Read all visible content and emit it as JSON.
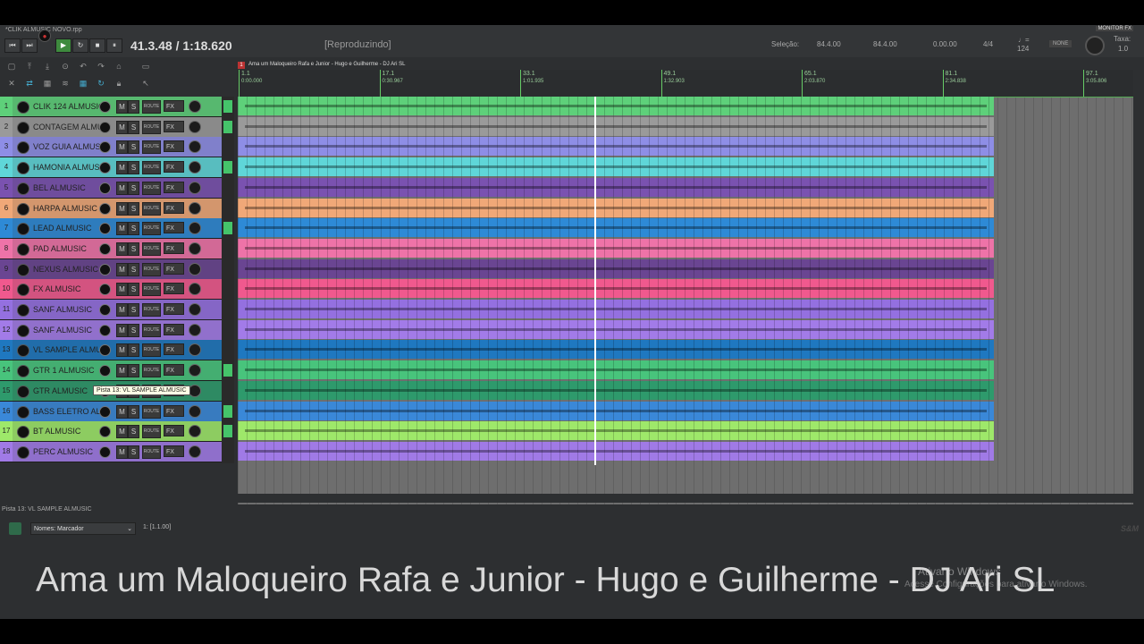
{
  "window": {
    "title": "*CLIK ALMUSIC NOVO.rpp",
    "monitor_fx": "MONITOR FX"
  },
  "transport": {
    "position": "41.3.48 / 1:18.620",
    "state": "[Reproduzindo]",
    "buttons": [
      "⏮",
      "⏭",
      "●",
      "▶",
      "↻",
      "■",
      "⏸"
    ]
  },
  "selection": {
    "label": "Seleção:",
    "start": "84.4.00",
    "end": "84.4.00",
    "length": "0.00.00",
    "timesig": "4/4",
    "bpm_icon": "♩=",
    "bpm": "124",
    "metronome": "NONE",
    "rate_label": "Taxa:",
    "rate": "1.0"
  },
  "project": {
    "marker_num": "1",
    "marker_label": "Ama um Maloqueiro Rafa e Junior - Hugo e Guilherme - DJ Ari SL"
  },
  "ruler": [
    {
      "bar": "1.1",
      "time": "0:00.000"
    },
    {
      "bar": "17.1",
      "time": "0:30.967"
    },
    {
      "bar": "33.1",
      "time": "1:01.935"
    },
    {
      "bar": "49.1",
      "time": "1:32.903"
    },
    {
      "bar": "65.1",
      "time": "2:03.870"
    },
    {
      "bar": "81.1",
      "time": "2:34.838"
    },
    {
      "bar": "97.1",
      "time": "3:05.806"
    }
  ],
  "track_labels": {
    "mute": "M",
    "solo": "S",
    "route": "ROUTE",
    "fx": "FX"
  },
  "tracks": [
    {
      "num": "1",
      "name": "CLIK 124 ALMUSIC",
      "color": "#5ed07a"
    },
    {
      "num": "2",
      "name": "CONTAGEM ALMUSIC",
      "color": "#9a9a9a"
    },
    {
      "num": "3",
      "name": "VOZ GUIA ALMUSIC",
      "color": "#8e8ee6"
    },
    {
      "num": "4",
      "name": "HAMONIA ALMUSIC",
      "color": "#5fd6d8"
    },
    {
      "num": "5",
      "name": "BEL ALMUSIC",
      "color": "#7a52b0"
    },
    {
      "num": "6",
      "name": "HARPA ALMUSIC",
      "color": "#f0a878"
    },
    {
      "num": "7",
      "name": "LEAD ALMUSIC",
      "color": "#2e8ad6"
    },
    {
      "num": "8",
      "name": "PAD ALMUSIC",
      "color": "#ee73a8"
    },
    {
      "num": "9",
      "name": "NEXUS ALMUSIC",
      "color": "#6a4592"
    },
    {
      "num": "10",
      "name": "FX ALMUSIC",
      "color": "#f0598e"
    },
    {
      "num": "11",
      "name": "SANF ALMUSIC",
      "color": "#9470e0"
    },
    {
      "num": "12",
      "name": "SANF ALMUSIC",
      "color": "#a27be8"
    },
    {
      "num": "13",
      "name": "VL SAMPLE ALMUSIC",
      "color": "#1f78c0"
    },
    {
      "num": "14",
      "name": "GTR 1 ALMUSIC",
      "color": "#48c47c"
    },
    {
      "num": "15",
      "name": "GTR ALMUSIC",
      "color": "#2e9a6c"
    },
    {
      "num": "16",
      "name": "BASS ELETRO ALMUSIC",
      "color": "#3a88d8"
    },
    {
      "num": "17",
      "name": "BT ALMUSIC",
      "color": "#9ee86a"
    },
    {
      "num": "18",
      "name": "PERC ALMUSIC",
      "color": "#a07ae6"
    }
  ],
  "tooltip": "Pista 13: VL SAMPLE ALMUSIC",
  "status": {
    "track_hint": "Pista 13: VL SAMPLE ALMUSIC",
    "names_select": "Nomes: Marcador",
    "marker_info": "1:  [1.1.00]",
    "sm_logo": "S&M"
  },
  "overlay_title": "Ama um Maloqueiro Rafa e Junior - Hugo e Guilherme - DJ Ari SL",
  "windows_watermark": {
    "line1": "Ativar o Windows",
    "line2": "Acesse Configurações para ativar o Windows."
  }
}
